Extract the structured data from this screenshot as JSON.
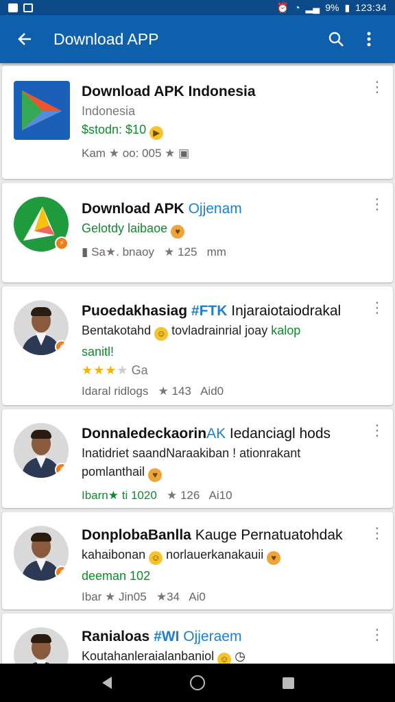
{
  "status_bar": {
    "time": "123:34",
    "battery": "9%",
    "icons": [
      "image-icon",
      "gallery-icon",
      "alarm-icon",
      "wifi-icon",
      "signal-icon",
      "battery-icon"
    ]
  },
  "app_bar": {
    "title": "Download APP",
    "icons": [
      "back-arrow-icon",
      "search-icon",
      "more-vert-icon"
    ]
  },
  "apps": [
    {
      "title": "Download APK Indonesia",
      "title_accent": "",
      "subtitle": "Indonesia",
      "price": "$stodn: $10",
      "meta_left": "Kam",
      "meta_mid": "oo: 005",
      "meta_right": "",
      "icon": "play-store-icon"
    },
    {
      "title": "Download APK",
      "title_accent": "Ojjenam",
      "subtitle": "Gelotdy laibaoe",
      "meta_left": "Sa",
      "meta_mid": "bnaoy",
      "meta_rating": "125",
      "meta_right": "mm",
      "icon": "play-round-icon"
    },
    {
      "title": "Puoedakhasiag",
      "title_hash": "#FTK",
      "title_rest": "Injaraiotaiodrakal",
      "line1": "Bentakotahd",
      "line1b": "tovladrainrial joay",
      "line1_accent": "kalop",
      "line2": "sanitl!",
      "star_label": "Ga",
      "meta_left": "Idaral ridlogs",
      "meta_rating": "143",
      "meta_right": "Aid0",
      "icon": "avatar-icon"
    },
    {
      "title": "Donnaledeckaorin",
      "title_accent": "AK",
      "title_rest": "Iedanciagl hods",
      "line1": "Inatidriet saandNaraakiban ! ationrakant",
      "line2": "pomlanthail",
      "meta_left": "Ibarn",
      "meta_mid": "ti 1020",
      "meta_rating": "126",
      "meta_right": "Ai10",
      "icon": "avatar-icon"
    },
    {
      "title": "DonplobaBanlla",
      "title_rest": "Kauge Pernatuatohdak",
      "line1": "kahaibonan",
      "line1b": "norlauerkanakauii",
      "line2": "deeman 102",
      "meta_left": "Ibar",
      "meta_mid": "Jin05",
      "meta_rating": "34",
      "meta_right": "Ai0",
      "icon": "avatar-icon"
    },
    {
      "title": "Ranialoas",
      "title_hash": "#WI",
      "title_accent": "Ojjeraem",
      "line1": "Koutahanleraialanbaniol",
      "icon": "avatar-icon"
    }
  ],
  "nav_bar": {
    "icons": [
      "nav-back-icon",
      "nav-home-icon",
      "nav-recents-icon"
    ]
  },
  "colors": {
    "app_bar": "#0f60ac",
    "status_bar": "#0d4a8a",
    "accent_blue": "#1e7fd1",
    "green": "#0f8a2c",
    "star_gold": "#f5b301",
    "badge_orange": "#f07e18"
  }
}
